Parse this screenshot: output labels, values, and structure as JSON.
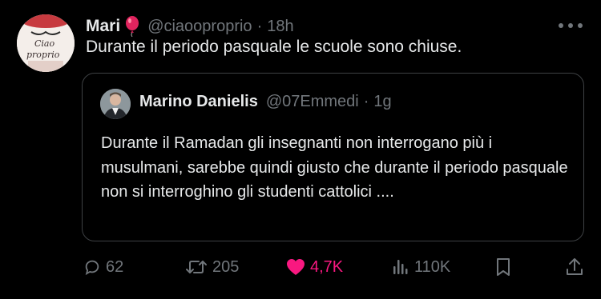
{
  "tweet": {
    "author_name": "Mari",
    "handle": "@ciaooproprio",
    "separator": "·",
    "time": "18h",
    "text": "Durante il periodo pasquale le scuole sono chiuse.",
    "avatar_text": "Ciao proprio"
  },
  "quoted": {
    "author_name": "Marino Danielis",
    "handle": "@07Emmedi",
    "separator": "·",
    "time": "1g",
    "text": "Durante il Ramadan gli insegnanti non interrogano più i musulmani, sarebbe quindi giusto che durante il periodo pasquale non si interroghino gli studenti cattolici ...."
  },
  "actions": {
    "replies": "62",
    "reposts": "205",
    "likes": "4,7K",
    "views": "110K"
  },
  "colors": {
    "background": "#000000",
    "text": "#e7e9ea",
    "secondary": "#71767b",
    "like": "#f91880",
    "border": "#3e4144"
  },
  "icons": [
    "reply-icon",
    "repost-icon",
    "like-icon",
    "views-icon",
    "bookmark-icon",
    "share-icon",
    "more-icon",
    "balloon-icon"
  ]
}
